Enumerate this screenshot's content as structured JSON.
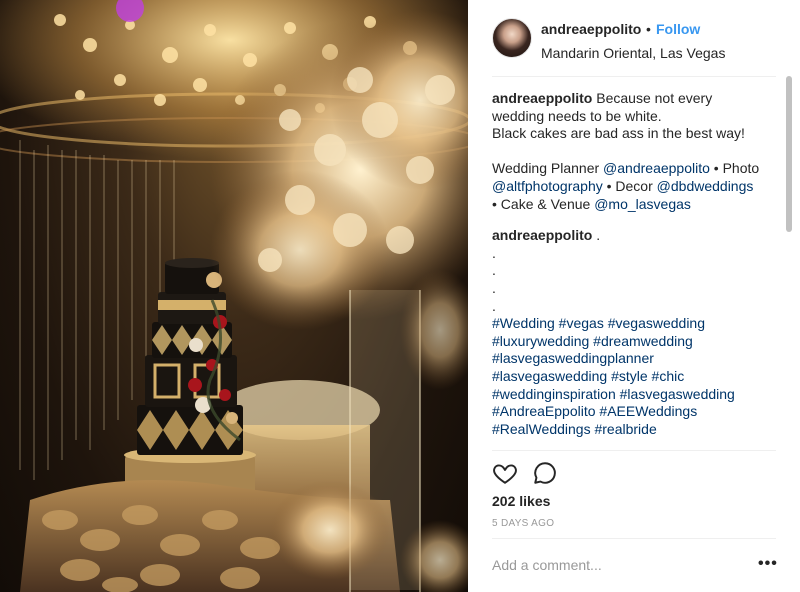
{
  "post": {
    "username": "andreaeppolito",
    "separator": "•",
    "follow_label": "Follow",
    "location": "Mandarin Oriental, Las Vegas",
    "caption": {
      "username": "andreaeppolito",
      "line1": " Because not every wedding needs to be white.",
      "line2": "Black cakes are bad ass in the best way!",
      "credits_prefix": "Wedding Planner ",
      "planner_handle": "@andreaeppolito",
      "photo_prefix": " • Photo ",
      "photo_handle": "@altfphotography",
      "decor_prefix": " • Decor ",
      "decor_handle": "@dbdweddings",
      "venue_prefix": " • Cake & Venue ",
      "venue_handle": "@mo_lasvegas"
    },
    "second_comment": {
      "username": "andreaeppolito",
      "lead": " .",
      "dots": [
        ".",
        ".",
        ".",
        "."
      ],
      "hashtag_lines": [
        "#Wedding #vegas #vegaswedding",
        "#luxurywedding #dreamwedding",
        "#lasvegasweddingplanner",
        "#lasvegaswedding #style #chic",
        "#weddinginspiration #lasvegaswedding",
        "#AndreaEppolito #AEEWeddings",
        "#RealWeddings #realbride"
      ]
    },
    "actions": {
      "like_icon": "heart-outline-icon",
      "comment_icon": "speech-bubble-icon"
    },
    "likes_label": "202 likes",
    "time_label": "5 DAYS AGO",
    "comment_placeholder": "Add a comment...",
    "more_label": "•••"
  },
  "colors": {
    "link": "#003569",
    "follow": "#3897f0",
    "muted": "#999999",
    "text": "#262626",
    "divider": "#efefef"
  }
}
